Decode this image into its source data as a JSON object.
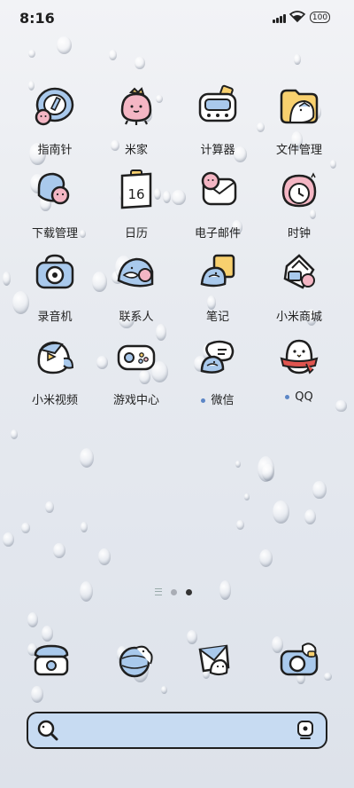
{
  "status_bar": {
    "time": "8:16",
    "battery": "100"
  },
  "apps": [
    {
      "label": "指南针",
      "icon": "compass-icon"
    },
    {
      "label": "米家",
      "icon": "mi-home-icon"
    },
    {
      "label": "计算器",
      "icon": "calculator-icon"
    },
    {
      "label": "文件管理",
      "icon": "file-manager-icon"
    },
    {
      "label": "下载管理",
      "icon": "download-manager-icon"
    },
    {
      "label": "日历",
      "icon": "calendar-icon",
      "day": "16"
    },
    {
      "label": "电子邮件",
      "icon": "email-icon"
    },
    {
      "label": "时钟",
      "icon": "clock-icon"
    },
    {
      "label": "录音机",
      "icon": "recorder-icon"
    },
    {
      "label": "联系人",
      "icon": "contacts-icon"
    },
    {
      "label": "笔记",
      "icon": "notes-icon"
    },
    {
      "label": "小米商城",
      "icon": "mi-store-icon"
    },
    {
      "label": "小米视频",
      "icon": "mi-video-icon"
    },
    {
      "label": "游戏中心",
      "icon": "game-center-icon"
    },
    {
      "label": "微信",
      "icon": "wechat-icon",
      "new_dot": true
    },
    {
      "label": "QQ",
      "icon": "qq-icon",
      "new_dot": true
    }
  ],
  "pager": {
    "pages": 2,
    "current": 2
  },
  "dock": [
    {
      "icon": "phone-icon"
    },
    {
      "icon": "browser-icon"
    },
    {
      "icon": "messages-icon"
    },
    {
      "icon": "camera-icon"
    }
  ],
  "search_bar": {
    "icon_left": "search-icon",
    "icon_right": "assistant-icon"
  },
  "colors": {
    "outline": "#1f1f1f",
    "blue": "#a9c9ec",
    "pink": "#f4b6c4",
    "yellow": "#f8d06e",
    "red": "#e0554f"
  }
}
